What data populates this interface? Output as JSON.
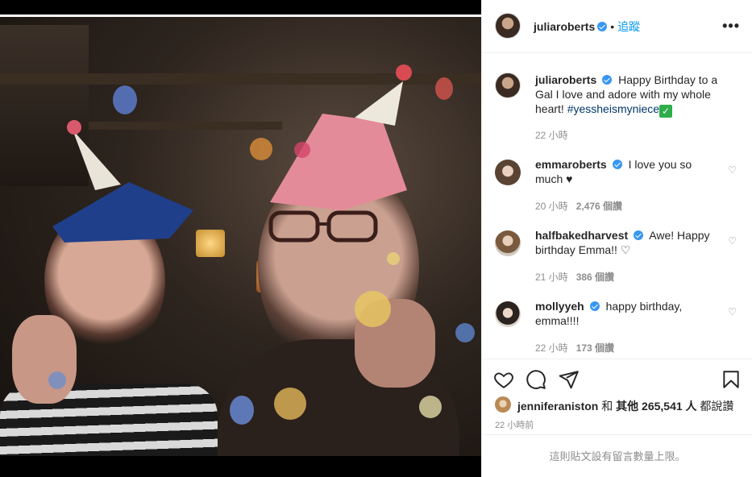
{
  "post": {
    "username": "juliaroberts",
    "separator": "•",
    "follow_label": "追蹤",
    "more_label": "•••"
  },
  "caption": {
    "username": "juliaroberts",
    "text": "Happy Birthday to a Gal I love and adore with my whole heart! ",
    "hashtag": "#yessheismyniece",
    "emoji": "✓",
    "time": "22 小時"
  },
  "comments": [
    {
      "username": "emmaroberts",
      "text": "I love you so much ♥",
      "time": "20 小時",
      "likes": "2,476 個讚"
    },
    {
      "username": "halfbakedharvest",
      "text": "Awe! Happy birthday Emma!! ♡",
      "time": "21 小時",
      "likes": "386 個讚"
    },
    {
      "username": "mollyyeh",
      "text": "happy birthday, emma!!!!",
      "time": "22 小時",
      "likes": "173 個讚"
    }
  ],
  "likes": {
    "user": "jenniferaniston",
    "and": " 和 ",
    "others": "其他 265,541 人",
    "suffix": " 都說讚"
  },
  "timestamp": "22 小時前",
  "footer": "這則貼文設有留言數量上限。",
  "colors": {
    "link_blue": "#0095f6",
    "verified": "#3897f0",
    "muted": "#8e8e8e"
  }
}
